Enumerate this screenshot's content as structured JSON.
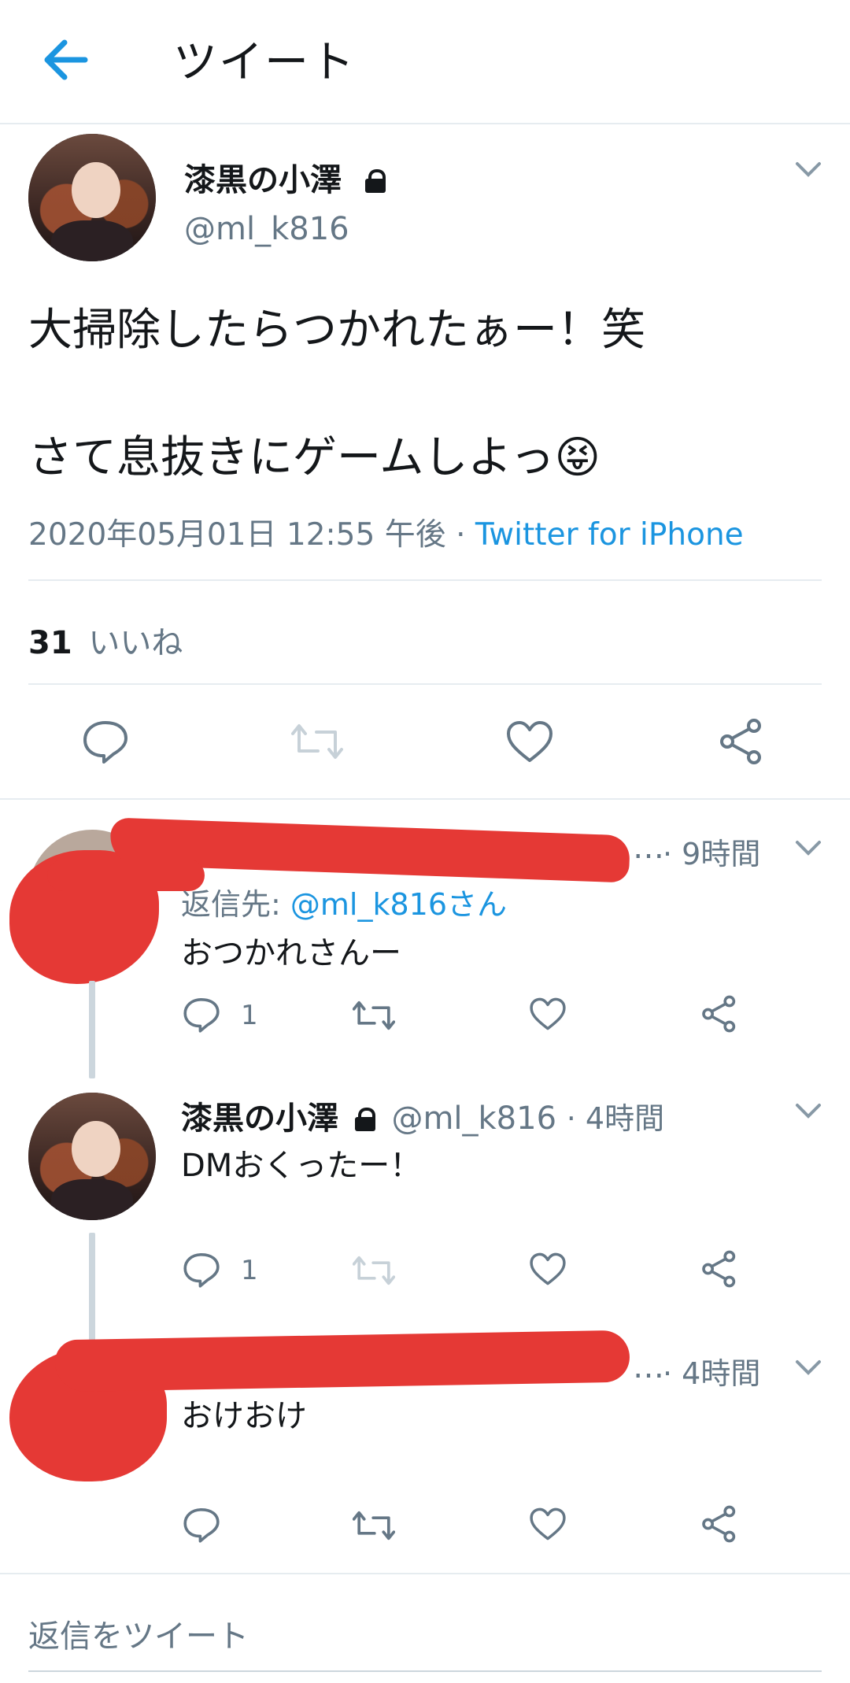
{
  "header": {
    "title": "ツイート"
  },
  "main_tweet": {
    "name": "漆黒の小澤",
    "handle": "@ml_k816",
    "line1": "大掃除したらつかれたぁー！笑",
    "line2": "さて息抜きにゲームしよっ",
    "emoji": "😝",
    "date": "2020年05月01日 12:55 午後",
    "separator": " · ",
    "source": "Twitter for iPhone",
    "likes_count": "31",
    "likes_label": "いいね"
  },
  "reply1": {
    "ellipsis": "…",
    "time": "· 9時間",
    "reply_to_label": "返信先: ",
    "reply_to_handle": "@ml_k816さん",
    "text": "おつかれさんー",
    "reply_count": "1"
  },
  "reply2": {
    "name": "漆黒の小澤",
    "handle": "@ml_k816",
    "time": "· 4時間",
    "text": "DMおくったー！",
    "reply_count": "1"
  },
  "reply3": {
    "ellipsis": "…",
    "time": "· 4時間",
    "text": "おけおけ"
  },
  "compose": {
    "placeholder": "返信をツイート"
  },
  "colors": {
    "accent": "#1b95e0",
    "redaction": "#e53935",
    "gray": "#657786"
  }
}
